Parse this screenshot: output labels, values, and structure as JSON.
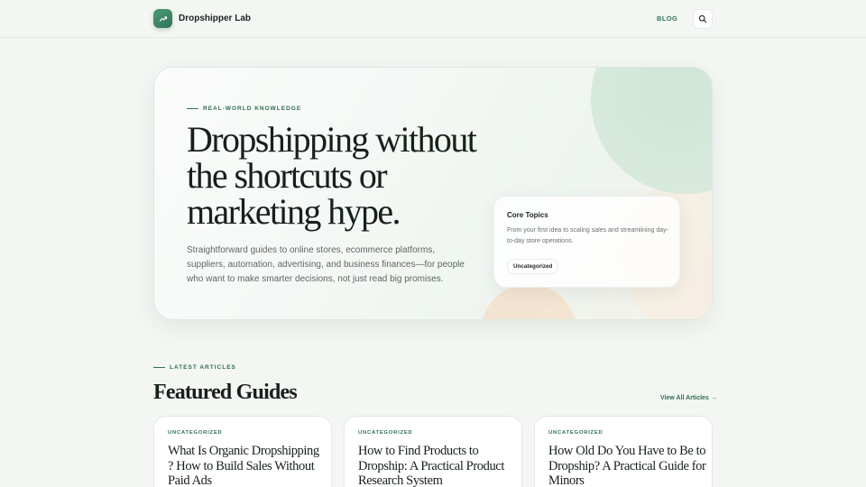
{
  "header": {
    "brand": "Dropshipper Lab",
    "logo_icon": "trending-up-icon",
    "nav_blog": "BLOG",
    "search_icon": "search-icon"
  },
  "hero": {
    "eyebrow": "REAL-WORLD KNOWLEDGE",
    "title": "Dropshipping without the shortcuts or marketing hype.",
    "description": "Straightforward guides to online stores, ecommerce platforms, suppliers, automation, advertising, and business finances—for people who want to make smarter decisions, not just read big promises.",
    "core_topics": {
      "title": "Core Topics",
      "description": "From your first idea to scaling sales and streamlining day-to-day store operations.",
      "chip": "Uncategorized"
    }
  },
  "latest": {
    "eyebrow": "LATEST ARTICLES",
    "title": "Featured Guides",
    "view_all": "View All Articles →",
    "articles": [
      {
        "category": "UNCATEGORIZED",
        "title": "What Is Organic Dropshipping ? How to Build Sales Without Paid Ads"
      },
      {
        "category": "UNCATEGORIZED",
        "title": "How to Find Products to Dropship: A Practical Product Research System"
      },
      {
        "category": "UNCATEGORIZED",
        "title": "How Old Do You Have to Be to Dropship? A Practical Guide for Minors"
      }
    ]
  },
  "colors": {
    "accent": "#2f7356",
    "background": "#f3f6f3",
    "blob_green": "#cfe6d8",
    "blob_peach": "#f5ddc6"
  }
}
